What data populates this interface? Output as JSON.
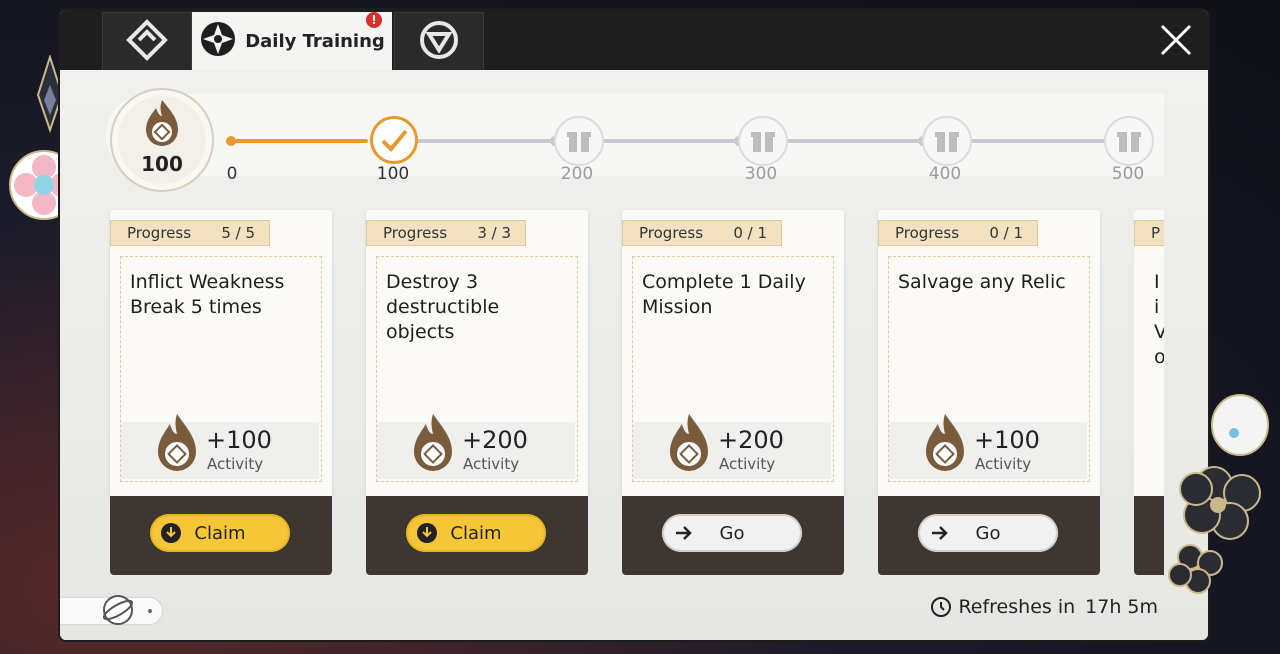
{
  "tabs": [
    {
      "icon": "fragments-icon",
      "label": ""
    },
    {
      "icon": "compass-icon",
      "label": "Daily Training",
      "alert": "!"
    },
    {
      "icon": "shield-icon",
      "label": ""
    }
  ],
  "activity": {
    "current": "100",
    "milestones": [
      "0",
      "100",
      "200",
      "300",
      "400",
      "500"
    ]
  },
  "tasks": [
    {
      "progress_label": "Progress",
      "progress": "5 / 5",
      "title": "Inflict Weakness Break 5 times",
      "reward": "+100",
      "reward_label": "Activity",
      "button": "Claim",
      "button_type": "claim"
    },
    {
      "progress_label": "Progress",
      "progress": "3 / 3",
      "title": "Destroy 3 destructible objects",
      "reward": "+200",
      "reward_label": "Activity",
      "button": "Claim",
      "button_type": "claim"
    },
    {
      "progress_label": "Progress",
      "progress": "0 / 1",
      "title": "Complete 1 Daily Mission",
      "reward": "+200",
      "reward_label": "Activity",
      "button": "Go",
      "button_type": "go"
    },
    {
      "progress_label": "Progress",
      "progress": "0 / 1",
      "title": "Salvage any Relic",
      "reward": "+100",
      "reward_label": "Activity",
      "button": "Go",
      "button_type": "go"
    }
  ],
  "partial_task": {
    "progress_label": "P",
    "title": "I i V o"
  },
  "refresh": {
    "label": "Refreshes in",
    "time": "17h 5m"
  },
  "colors": {
    "accent": "#e79a2e",
    "claim": "#f6c637",
    "alert": "#d9302c"
  }
}
